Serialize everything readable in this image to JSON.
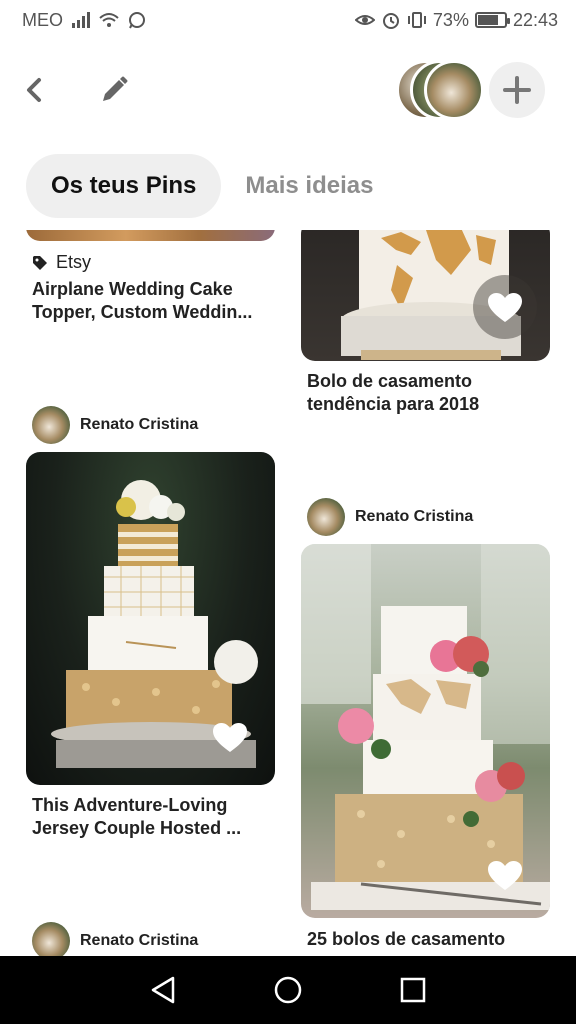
{
  "status_bar": {
    "carrier": "MEO",
    "battery_percent": "73%",
    "battery_level": 0.73,
    "time": "22:43"
  },
  "toolbar": {
    "back_icon": "chevron-left-icon",
    "edit_icon": "pencil-icon",
    "add_icon": "plus-icon"
  },
  "tabs": [
    {
      "label": "Os teus Pins",
      "active": true
    },
    {
      "label": "Mais ideias",
      "active": false
    }
  ],
  "pins": [
    {
      "source": "Etsy",
      "title_line1": "Airplane Wedding Cake",
      "title_line2": "Topper, Custom Weddin..."
    },
    {
      "title_line1": "Bolo de casamento",
      "title_line2": "tendência para 2018"
    },
    {
      "user": "Renato Cristina",
      "title_line1": "This Adventure-Loving",
      "title_line2": "Jersey Couple Hosted ..."
    },
    {
      "user": "Renato Cristina",
      "title_line1": "25 bolos de casamento"
    },
    {
      "user": "Renato Cristina"
    }
  ],
  "colors": {
    "tab_active_bg": "#efefef",
    "tab_inactive_text": "#8e8e8e",
    "nav_bar_bg": "#000000"
  }
}
